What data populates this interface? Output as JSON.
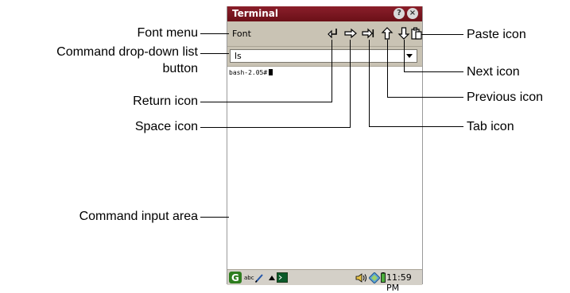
{
  "window": {
    "title": "Terminal",
    "help_glyph": "?",
    "close_glyph": "×"
  },
  "toolbar": {
    "font_menu": "Font",
    "icons": [
      "return-icon",
      "space-icon",
      "tab-icon",
      "previous-icon",
      "next-icon",
      "paste-icon"
    ]
  },
  "command": {
    "value": "ls"
  },
  "terminal": {
    "prompt": "bash-2.05#"
  },
  "taskbar": {
    "abc": "abc",
    "clock": "11:59 PM"
  },
  "callouts": {
    "font_menu": "Font menu",
    "command_dropdown_line1": "Command drop-down list",
    "command_dropdown_line2": "button",
    "return_icon": "Return icon",
    "space_icon": "Space icon",
    "command_input_area": "Command input area",
    "paste_icon": "Paste icon",
    "next_icon": "Next icon",
    "previous_icon": "Previous icon",
    "tab_icon": "Tab icon"
  },
  "colors": {
    "titlebar": "#7a1620",
    "toolbar": "#c9c3b4",
    "taskbar": "#d4d0c8"
  }
}
